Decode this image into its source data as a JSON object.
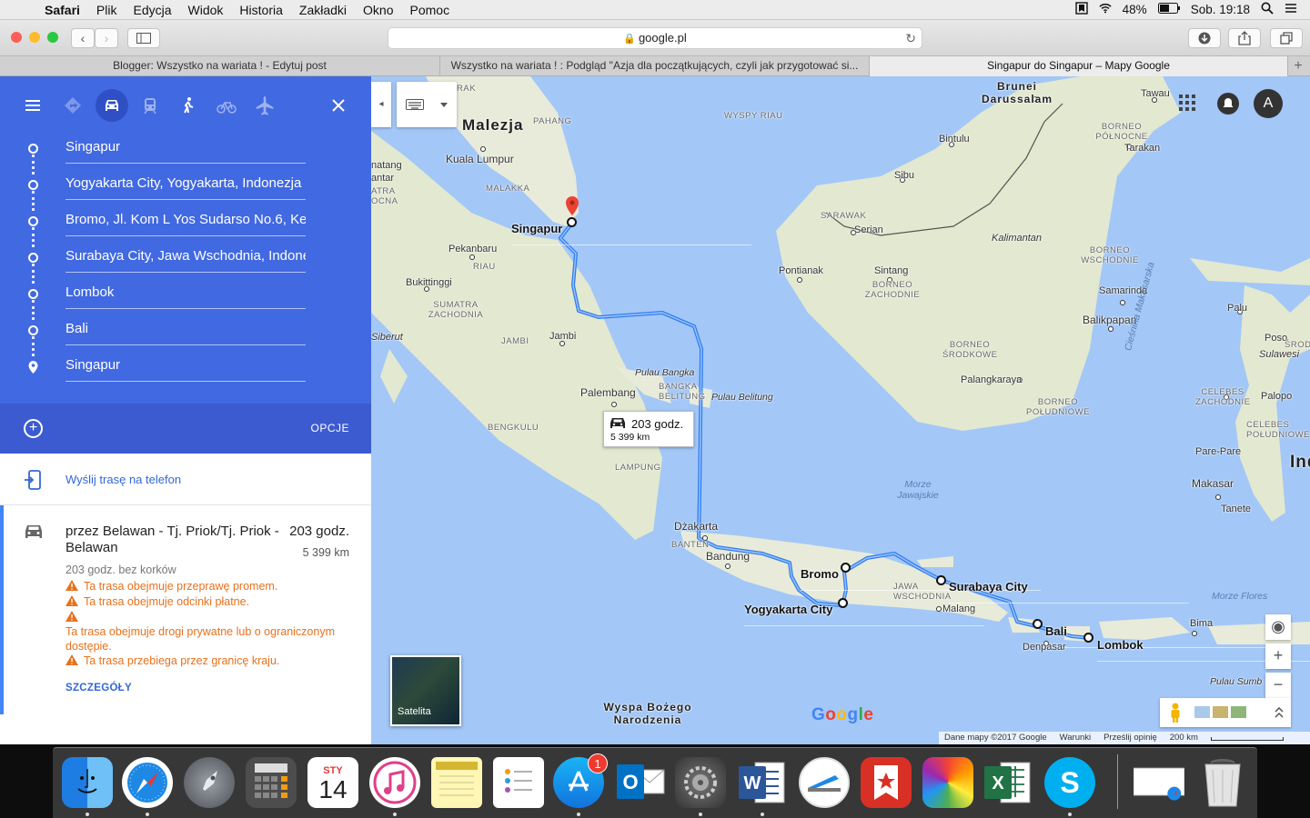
{
  "menubar": {
    "app": "Safari",
    "items": [
      "Plik",
      "Edycja",
      "Widok",
      "Historia",
      "Zakładki",
      "Okno",
      "Pomoc"
    ],
    "battery": "48%",
    "clock": "Sob. 19:18"
  },
  "browser": {
    "url": "google.pl",
    "tabs": [
      "Blogger: Wszystko na wariata ! - Edytuj post",
      "Wszystko na wariata ! : Podgląd \"Azja dla początkujących, czyli jak przygotować si...",
      "Singapur do Singapur – Mapy Google"
    ],
    "active_tab": 2
  },
  "directions": {
    "travel_modes": [
      "best-route",
      "driving",
      "transit",
      "walking",
      "cycling",
      "flight"
    ],
    "active_mode": "driving",
    "waypoints": [
      "Singapur",
      "Yogyakarta City, Yogyakarta, Indonezja",
      "Bromo, Jl. Kom L Yos Sudarso No.6, Ke",
      "Surabaya City, Jawa Wschodnia, Indone",
      "Lombok",
      "Bali",
      "Singapur"
    ],
    "options_label": "OPCJE",
    "send_to_phone": "Wyślij trasę na telefon",
    "route": {
      "via": "przez Belawan - Tj. Priok/Tj. Priok - Belawan",
      "duration": "203 godz.",
      "distance": "5 399 km",
      "traffic_note": "203 godz. bez korków",
      "warnings": [
        "Ta trasa obejmuje przeprawę promem.",
        "Ta trasa obejmuje odcinki płatne.",
        "Ta trasa obejmuje drogi prywatne lub o ograniczonym dostępie.",
        "Ta trasa przebiega przez granicę kraju."
      ],
      "details_label": "SZCZEGÓŁY"
    }
  },
  "map": {
    "bubble": {
      "duration": "203 godz.",
      "distance": "5 399 km"
    },
    "satellite_label": "Satelita",
    "google_logo": "Google",
    "footer": [
      "Dane mapy ©2017 Google",
      "Warunki",
      "Prześlij opinię",
      "200 km"
    ],
    "avatar_letter": "A",
    "labels": {
      "malezja": "Malezja",
      "kuala_lumpur": "Kuala Lumpur",
      "pahang": "PAHANG",
      "malakka": "MALAKKA",
      "wyspy_riau": "WYSPY RIAU",
      "singapur": "Singapur",
      "pekanbaru": "Pekanbaru",
      "riau": "RIAU",
      "bukittinggi": "Bukittinggi",
      "sumatra_zach": "SUMATRA ZACHODNIA",
      "siberut": "Siberut",
      "jambi_r": "JAMBI",
      "jambi": "Jambi",
      "pulau_bangka": "Pulau Bangka",
      "bangka_belitung": "BANGKA BELITUNG",
      "pulau_belitung": "Pulau Belitung",
      "palembang": "Palembang",
      "bengkulu": "BENGKULU",
      "lampung": "LAMPUNG",
      "dzakarta": "Dżakarta",
      "banten": "BANTEN",
      "bandung": "Bandung",
      "bromo": "Bromo",
      "yogyakarta": "Yogyakarta City",
      "surabaya": "Surabaya City",
      "jawa_wsch": "JAWA WSCHODNIA",
      "malang": "Malang",
      "bali": "Bali",
      "denpasar": "Denpasar",
      "lombok": "Lombok",
      "brunei": "Brunei Darussalam",
      "tawau": "Tawau",
      "borneo_pn": "BORNEO PÓŁNOCNE",
      "bintulu": "Bintulu",
      "tarakan": "Tarakan",
      "sibu": "Sibu",
      "sarawak": "SARAWAK",
      "serian": "Serian",
      "kalimantan": "Kalimantan",
      "borneo_wsch": "BORNEO WSCHODNIE",
      "pontianak": "Pontianak",
      "sintang": "Sintang",
      "borneo_zach": "BORNEO ZACHODNIE",
      "samarinda": "Samarinda",
      "balikpapan": "Balikpapan",
      "borneo_sr": "BORNEO ŚRODKOWE",
      "palangkaraya": "Palangkaraya",
      "borneo_pd": "BORNEO POŁUDNIOWE",
      "ciesnina": "Cieśnina Makasarska",
      "morze_jawajskie": "Morze Jawajskie",
      "morze_flores": "Morze Flores",
      "wyspa_bozego": "Wyspa Bożego Narodzenia",
      "palu": "Palu",
      "poso": "Poso",
      "sulawesi": "Sulawesi",
      "celebes_zach": "CELEBES ZACHODNIE",
      "palopo": "Palopo",
      "celebes_pd": "CELEBES POŁUDNIOWE",
      "pare_pare": "Pare-Pare",
      "makasar": "Makasar",
      "tanete": "Tanete",
      "bima": "Bima",
      "pulau_sumba": "Pulau Sumb",
      "indonesia": "Ind",
      "natang": "natang",
      "antar": "antar",
      "atra": "ATRA",
      "ocna": "OCNA",
      "rak": "RAK",
      "srodko": "ŚRODKO"
    }
  },
  "dock": {
    "calendar_month": "STY",
    "calendar_day": "14",
    "appstore_badge": "1"
  }
}
